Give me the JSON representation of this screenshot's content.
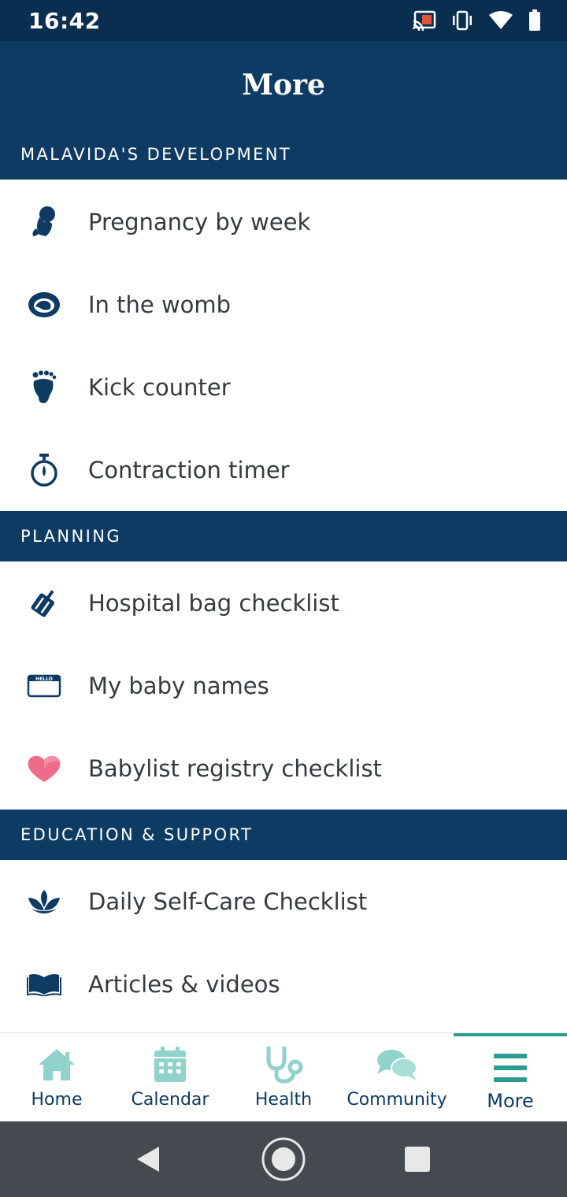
{
  "status_bar": {
    "time": "16:42",
    "icons": [
      "cast-icon",
      "vibrate-icon",
      "wifi-icon",
      "battery-icon"
    ]
  },
  "app_bar": {
    "title": "More"
  },
  "sections": [
    {
      "header": "MALAVIDA'S DEVELOPMENT",
      "items": [
        {
          "label": "Pregnancy by week",
          "icon": "fetus-icon"
        },
        {
          "label": "In the womb",
          "icon": "womb-icon"
        },
        {
          "label": "Kick counter",
          "icon": "footprint-icon"
        },
        {
          "label": "Contraction timer",
          "icon": "stopwatch-icon"
        }
      ]
    },
    {
      "header": "PLANNING",
      "items": [
        {
          "label": "Hospital bag checklist",
          "icon": "suitcase-icon"
        },
        {
          "label": "My baby names",
          "icon": "name-tag-icon",
          "tag_text": "HELLO"
        },
        {
          "label": "Babylist registry checklist",
          "icon": "heart-icon"
        }
      ]
    },
    {
      "header": "EDUCATION & SUPPORT",
      "items": [
        {
          "label": "Daily Self-Care Checklist",
          "icon": "lotus-icon"
        },
        {
          "label": "Articles & videos",
          "icon": "book-icon"
        }
      ]
    }
  ],
  "bottom_nav": [
    {
      "label": "Home",
      "icon": "home-icon"
    },
    {
      "label": "Calendar",
      "icon": "calendar-icon"
    },
    {
      "label": "Health",
      "icon": "stethoscope-icon"
    },
    {
      "label": "Community",
      "icon": "chat-bubbles-icon"
    },
    {
      "label": "More",
      "icon": "menu-icon",
      "active": true
    }
  ],
  "colors": {
    "primary": "#0e3b63",
    "status_bar": "#0a2e4f",
    "accent": "#2a9d91",
    "nav_icon": "#8fd3cc",
    "heart": "#f06b8a",
    "system_nav": "#454a50"
  }
}
